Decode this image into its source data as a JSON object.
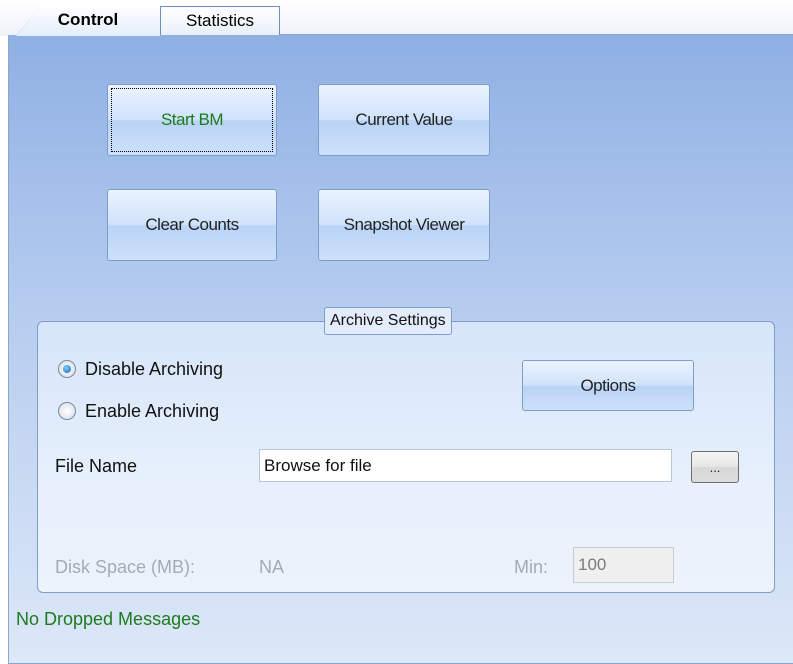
{
  "tabs": {
    "control": "Control",
    "statistics": "Statistics"
  },
  "buttons": {
    "start_bm": "Start BM",
    "current_value": "Current Value",
    "clear_counts": "Clear Counts",
    "snapshot_viewer": "Snapshot Viewer"
  },
  "archive": {
    "group_title": "Archive Settings",
    "disable_label": "Disable Archiving",
    "enable_label": "Enable Archiving",
    "selected": "Disable Archiving",
    "options_label": "Options",
    "file_name_label": "File Name",
    "file_name_value": "Browse for file",
    "browse_label": "...",
    "disk_space_label": "Disk Space (MB):",
    "disk_space_value": "NA",
    "min_label": "Min:",
    "min_value": "100"
  },
  "status": {
    "text": "No Dropped Messages"
  },
  "colors": {
    "status_text": "#1f7a1f",
    "panel_top": "#8fb0e4",
    "panel_bottom": "#dde8f8"
  }
}
